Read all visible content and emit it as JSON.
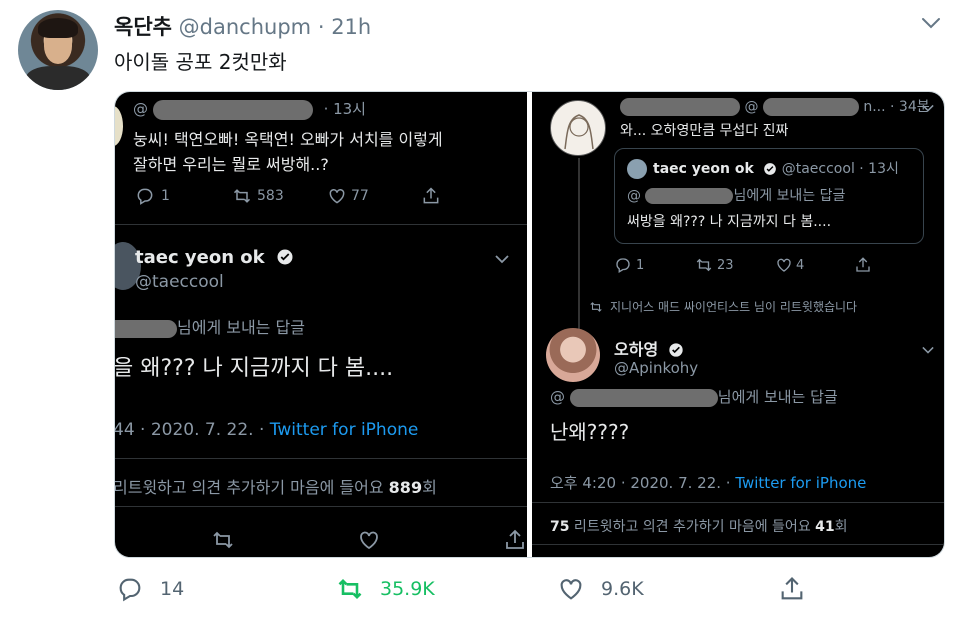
{
  "tweet": {
    "display_name": "옥단추",
    "handle": "@danchupm",
    "separator": "·",
    "time": "21h",
    "text": "아이돌 공포 2컷만화"
  },
  "left_panel": {
    "reply": {
      "handle_partial": "@",
      "time": "· 13시",
      "text_line1": "눙씨! 택연오빠! 옥택연! 오빠가 서치를 이렇게",
      "text_line2": "잘하면 우리는 뭘로 써방해..?",
      "reply_count": "1",
      "retweet_count": "583",
      "like_count": "77"
    },
    "main": {
      "name": "taec yeon ok",
      "handle": "@taeccool",
      "replying_suffix": "님에게 보내는 답글",
      "text": "을 왜??? 나 지금까지 다 봄....",
      "time_partial": "44 · 2020. 7. 22. · ",
      "source": "Twitter for iPhone",
      "stats_text": "리트윗하고 의견 추가하기   마음에 들어요 ",
      "likes_count": "889",
      "likes_suffix": "회"
    }
  },
  "right_panel": {
    "reply": {
      "handle_partial": "@",
      "time": "n... · 34분",
      "text": "와... 오하영만큼 무섭다 진짜",
      "quote": {
        "name": "taec yeon ok",
        "handle": "@taeccool · 13시",
        "replying_prefix": "@",
        "replying_suffix": "님에게 보내는 답글",
        "text": "써방을 왜??? 나 지금까지 다 봄...."
      },
      "reply_count": "1",
      "retweet_count": "23",
      "like_count": "4"
    },
    "retweeted_by": "지니어스 매드 싸이언티스트 님이 리트윗했습니다",
    "main": {
      "name": "오하영",
      "handle": "@Apinkohy",
      "replying_prefix": "@",
      "replying_suffix": "님에게 보내는 답글",
      "text": "난왜????",
      "time": "오후 4:20 · 2020. 7. 22. · ",
      "source": "Twitter for iPhone",
      "retweets": "75",
      "stats_mid": " 리트윗하고 의견 추가하기  마음에 들어요 ",
      "likes": "41",
      "likes_suffix": "회"
    }
  },
  "actions": {
    "replies": "14",
    "retweets": "35.9K",
    "likes": "9.6K"
  },
  "colors": {
    "retweet_green": "#17bf63",
    "link_blue": "#1d9bf0",
    "panel_bg": "#000000"
  }
}
